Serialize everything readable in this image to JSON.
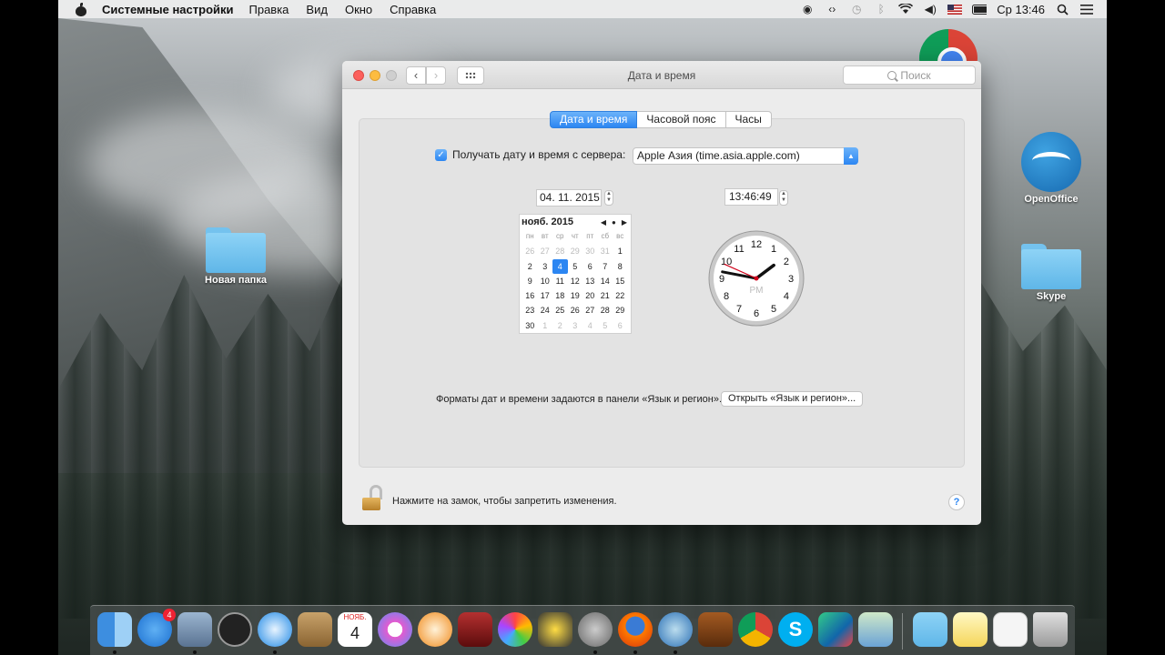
{
  "menubar": {
    "app_name": "Системные настройки",
    "items": [
      "Правка",
      "Вид",
      "Окно",
      "Справка"
    ],
    "clock": "Ср 13:46"
  },
  "desktop": {
    "folder1_label": "Новая папка",
    "openoffice_label": "OpenOffice",
    "skype_label": "Skype"
  },
  "window": {
    "title": "Дата и время",
    "search_placeholder": "Поиск",
    "tabs": [
      "Дата и время",
      "Часовой пояс",
      "Часы"
    ],
    "active_tab": 0,
    "server_checkbox_label": "Получать дату и время с сервера:",
    "server_checked": true,
    "server_value": "Apple Азия (time.asia.apple.com)",
    "date_value": "04. 11. 2015",
    "time_value": "13:46:49",
    "calendar": {
      "month_label": "нояб. 2015",
      "weekdays": [
        "пн",
        "вт",
        "ср",
        "чт",
        "пт",
        "сб",
        "вс"
      ],
      "days": [
        [
          "26",
          "27",
          "28",
          "29",
          "30",
          "31",
          "1"
        ],
        [
          "2",
          "3",
          "4",
          "5",
          "6",
          "7",
          "8"
        ],
        [
          "9",
          "10",
          "11",
          "12",
          "13",
          "14",
          "15"
        ],
        [
          "16",
          "17",
          "18",
          "19",
          "20",
          "21",
          "22"
        ],
        [
          "23",
          "24",
          "25",
          "26",
          "27",
          "28",
          "29"
        ],
        [
          "30",
          "1",
          "2",
          "3",
          "4",
          "5",
          "6"
        ]
      ],
      "selected_day": "4"
    },
    "analog_clock": {
      "numbers": [
        "12",
        "1",
        "2",
        "3",
        "4",
        "5",
        "6",
        "7",
        "8",
        "9",
        "10",
        "11"
      ],
      "ampm": "PM",
      "hour": 13,
      "minute": 46,
      "second": 49
    },
    "formats_note": "Форматы дат и времени задаются в панели «Язык и регион».",
    "region_button": "Открыть «Язык и регион»...",
    "lock_note": "Нажмите на замок, чтобы запретить изменения.",
    "help_label": "?"
  },
  "dock": {
    "appstore_badge": "4",
    "calendar_month": "НОЯБ.",
    "calendar_day": "4"
  },
  "colors": {
    "accent": "#2c86f2",
    "close": "#fc605c",
    "minimize": "#fdbc40"
  }
}
